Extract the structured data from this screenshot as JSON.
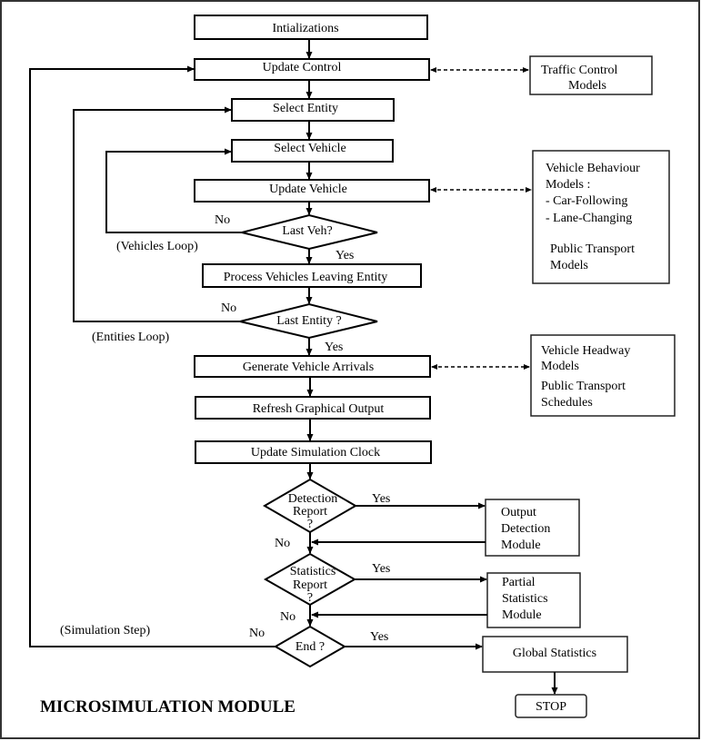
{
  "title": "MICROSIMULATION  MODULE",
  "process_steps": {
    "initializations": "Intializations",
    "update_control": "Update Control",
    "select_entity": "Select Entity",
    "select_vehicle": "Select Vehicle",
    "update_vehicle": "Update Vehicle",
    "process_leaving": "Process Vehicles Leaving Entity",
    "generate_arrivals": "Generate Vehicle Arrivals",
    "refresh_output": "Refresh Graphical Output",
    "update_clock": "Update Simulation Clock",
    "global_statistics": "Global Statistics",
    "stop": "STOP"
  },
  "decisions": {
    "last_veh": "Last Veh?",
    "last_entity": "Last Entity ?",
    "detection_report": [
      "Detection",
      "Report",
      "?"
    ],
    "statistics_report": [
      "Statistics",
      "Report",
      "?"
    ],
    "end": "End ?"
  },
  "side_models": {
    "traffic_control": [
      "Traffic Control",
      "Models"
    ],
    "vehicle_behaviour": [
      "Vehicle Behaviour",
      "Models :",
      "- Car-Following",
      "- Lane-Changing",
      "Public Transport",
      "Models"
    ],
    "headway": [
      "Vehicle Headway",
      "Models",
      "Public Transport",
      "Schedules"
    ],
    "output_detection": [
      "Output",
      "Detection",
      "Module"
    ],
    "partial_statistics": [
      "Partial",
      "Statistics",
      "Module"
    ]
  },
  "edge_labels": {
    "yes": "Yes",
    "no": "No",
    "vehicles_loop": "(Vehicles Loop)",
    "entities_loop": "(Entities Loop)",
    "simulation_step": "(Simulation Step)"
  }
}
